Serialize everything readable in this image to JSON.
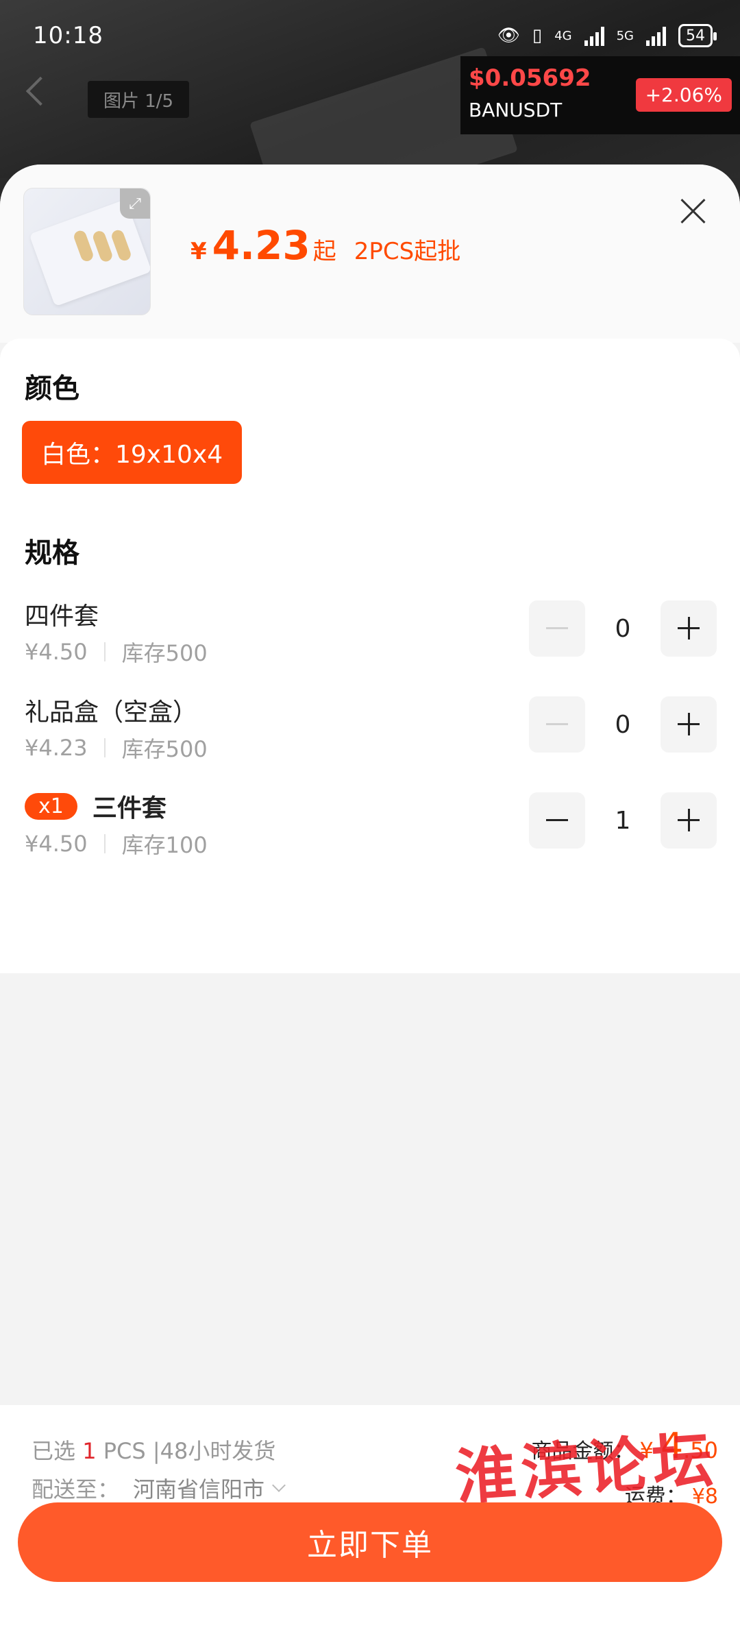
{
  "status_bar": {
    "time": "10:18",
    "net1": "4G",
    "net2": "5G",
    "battery": "54"
  },
  "viewer": {
    "image_counter": "图片 1/5"
  },
  "ticker": {
    "price": "$0.05692",
    "symbol": "BANUSDT",
    "change": "+2.06%"
  },
  "product": {
    "price_currency": "¥",
    "price": "4.23",
    "price_suffix": "起",
    "min_order": "2PCS起批"
  },
  "color_section": {
    "title": "颜色",
    "selected_option": "白色：19x10x4"
  },
  "spec_section": {
    "title": "规格",
    "items": [
      {
        "name": "四件套",
        "price": "¥4.50",
        "stock": "库存500",
        "qty": "0",
        "badge": ""
      },
      {
        "name": "礼品盒（空盒）",
        "price": "¥4.23",
        "stock": "库存500",
        "qty": "0",
        "badge": ""
      },
      {
        "name": "三件套",
        "price": "¥4.50",
        "stock": "库存100",
        "qty": "1",
        "badge": "x1"
      }
    ]
  },
  "footer": {
    "selected_prefix": "已选 ",
    "selected_count": "1",
    "selected_suffix": " PCS |48小时发货",
    "ship_label": "配送至：",
    "ship_address": "河南省信阳市",
    "amount_label": "商品金额：",
    "amount_currency": "¥",
    "amount_int": "4",
    "amount_dec": ".50",
    "fee_label": "运费：",
    "fee_value": "¥8",
    "watermark": "淮滨论坛",
    "order_button": "立即下单"
  },
  "colors": {
    "accent": "#ff4a0a",
    "button": "#ff5a2a",
    "ticker_red": "#f0393f"
  }
}
